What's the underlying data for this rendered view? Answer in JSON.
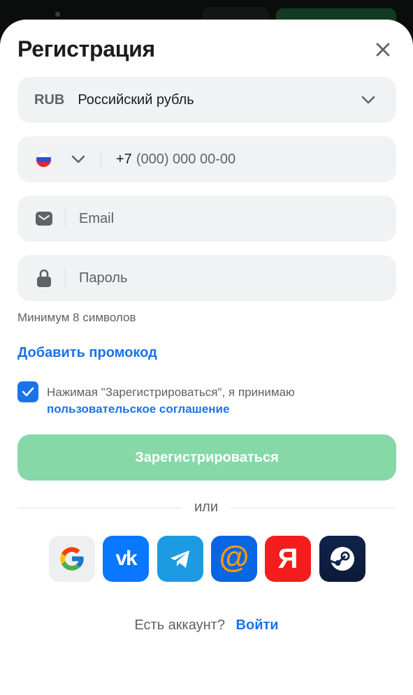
{
  "modal": {
    "title": "Регистрация"
  },
  "currency": {
    "code": "RUB",
    "name": "Российский рубль"
  },
  "phone": {
    "country": "Russia",
    "prefix": "+7",
    "placeholder": "(000) 000 00-00"
  },
  "email": {
    "placeholder": "Email"
  },
  "password": {
    "placeholder": "Пароль",
    "hint": "Минимум 8 символов"
  },
  "promo": {
    "label": "Добавить промокод"
  },
  "agreement": {
    "checked": true,
    "text": "Нажимая \"Зарегистрироваться\", я принимаю",
    "link": "пользовательское соглашение"
  },
  "submit": {
    "label": "Зарегистрироваться"
  },
  "divider": {
    "label": "или"
  },
  "social": [
    {
      "name": "Google",
      "icon": "google-icon"
    },
    {
      "name": "VK",
      "icon": "vk-icon",
      "glyph": "vk"
    },
    {
      "name": "Telegram",
      "icon": "telegram-icon"
    },
    {
      "name": "Mail.ru",
      "icon": "mail-ru-icon",
      "glyph": "@"
    },
    {
      "name": "Yandex",
      "icon": "yandex-icon",
      "glyph": "Я"
    },
    {
      "name": "Steam",
      "icon": "steam-icon"
    }
  ],
  "footer": {
    "question": "Есть аккаунт?",
    "login": "Войти"
  },
  "colors": {
    "accent": "#1a73e8",
    "submit_disabled": "#86d9a7",
    "field_bg": "#f1f2f4",
    "checkbox": "#1a73e8"
  }
}
